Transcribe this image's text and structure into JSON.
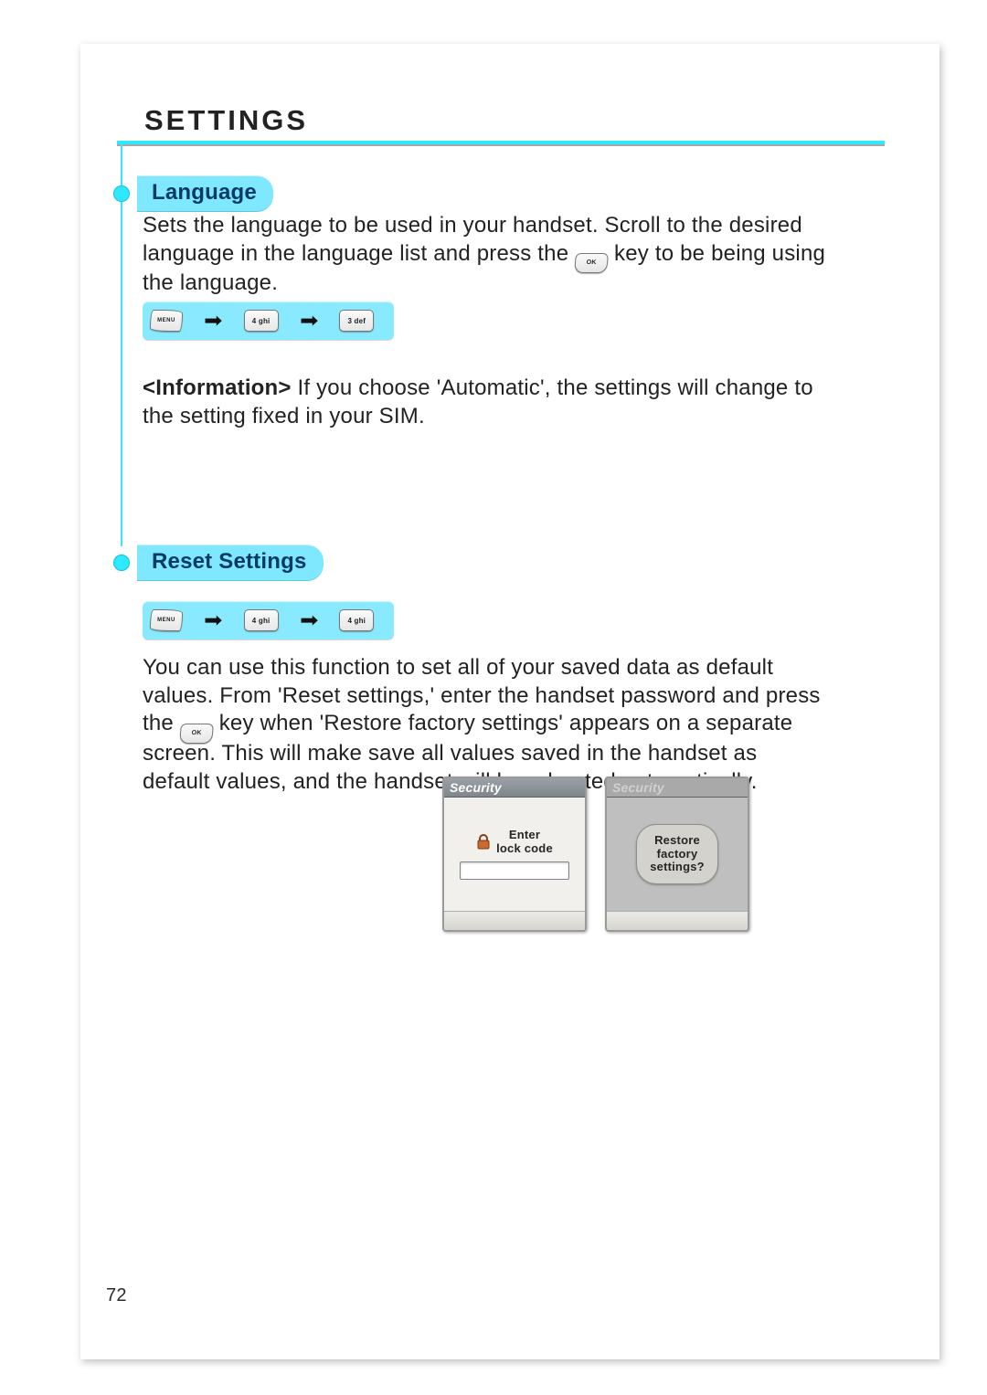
{
  "page_number": "72",
  "header": {
    "title": "SETTINGS"
  },
  "section_language": {
    "heading": "Language",
    "body_before_key": "Sets the language to be used in your handset. Scroll to the desired language in the language list and press the ",
    "body_after_key": " key to be being using the language.",
    "info_label": "<Information>",
    "info_text": " If you choose 'Automatic', the settings will change to the setting fixed in your SIM.",
    "seq": {
      "k1": "MENU",
      "k2": "4 ghi",
      "k3": "3 def"
    }
  },
  "section_reset": {
    "heading": "Reset Settings",
    "seq": {
      "k1": "MENU",
      "k2": "4 ghi",
      "k3": "4 ghi"
    },
    "body_before_key": "You can use this function to set all of your saved data as default values. From 'Reset settings,' enter the handset password and press the ",
    "body_after_key": " key when 'Restore factory settings' appears on a separate screen. This will make save all values saved in the handset as default values, and the handset will be rebooted automatically."
  },
  "phone_left": {
    "title": "Security",
    "label_line1": "Enter",
    "label_line2": "lock code"
  },
  "phone_right": {
    "title": "Security",
    "confirm_line1": "Restore",
    "confirm_line2": "factory",
    "confirm_line3": "settings?"
  },
  "keys": {
    "ok": "OK"
  }
}
